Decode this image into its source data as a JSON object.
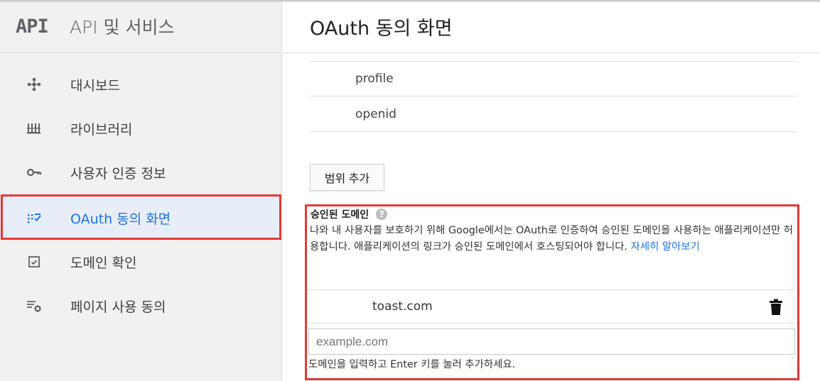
{
  "sidebar": {
    "logo": "API",
    "title": "API 및 서비스",
    "items": [
      {
        "label": "대시보드",
        "icon": "dashboard-icon"
      },
      {
        "label": "라이브러리",
        "icon": "library-icon"
      },
      {
        "label": "사용자 인증 정보",
        "icon": "key-icon"
      },
      {
        "label": "OAuth 동의 화면",
        "icon": "oauth-consent-icon",
        "active": true
      },
      {
        "label": "도메인 확인",
        "icon": "checkbox-icon"
      },
      {
        "label": "페이지 사용 동의",
        "icon": "settings-list-icon"
      }
    ]
  },
  "header": {
    "title": "OAuth 동의 화면"
  },
  "scopes": {
    "rows": [
      "profile",
      "openid"
    ],
    "add_button": "범위 추가"
  },
  "authorized_domains": {
    "heading": "승인된 도메인",
    "description": "나와 내 사용자를 보호하기 위해 Google에서는 OAuth로 인증하여 승인된 도메인을 사용하는 애플리케이션만 허용합니다. 애플리케이션의 링크가 승인된 도메인에서 호스팅되어야 합니다. ",
    "learn_more": "자세히 알아보기",
    "domains": [
      "toast.com"
    ],
    "input_placeholder": "example.com",
    "input_hint": "도메인을 입력하고 Enter 키를 눌러 추가하세요."
  },
  "colors": {
    "accent": "#1a73e8",
    "highlight_border": "#e53935",
    "active_bg": "#e8eef9"
  }
}
